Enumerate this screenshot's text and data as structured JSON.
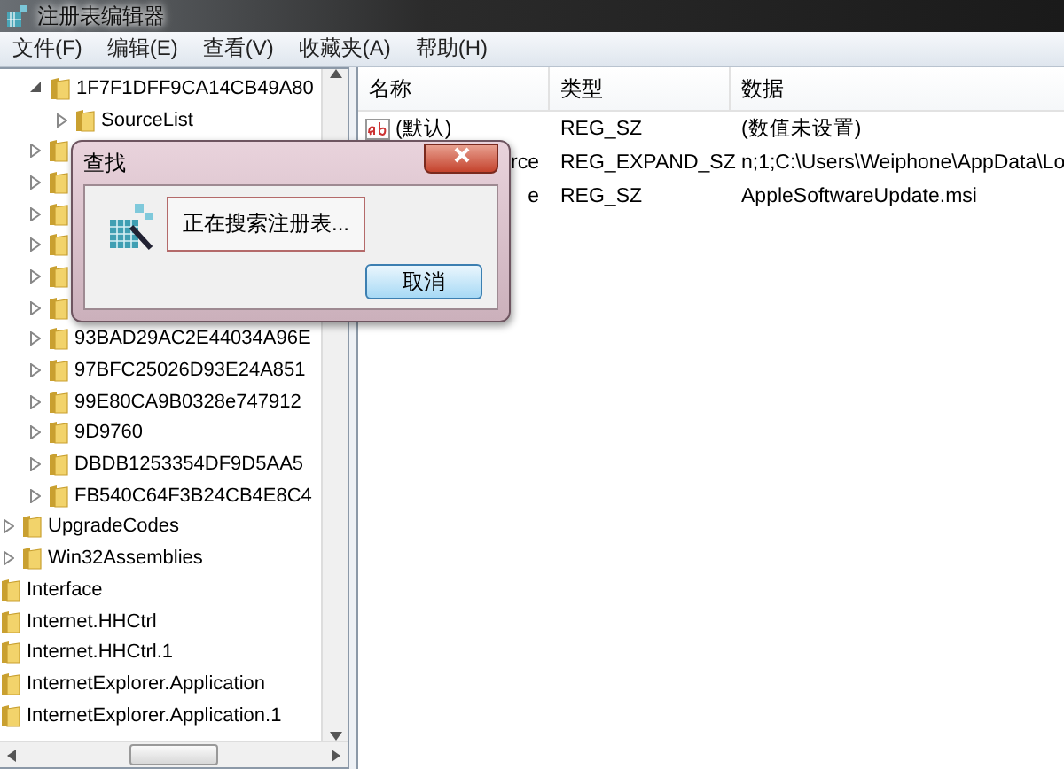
{
  "window": {
    "title": "注册表编辑器"
  },
  "menu": [
    "文件(F)",
    "编辑(E)",
    "查看(V)",
    "收藏夹(A)",
    "帮助(H)"
  ],
  "tree": [
    {
      "children": [
        {
          "children": [
            {
              "label": "1F7F1DFF9CA14CB49A80",
              "expanded": true,
              "children": [
                {
                  "label": "SourceList",
                  "expanded": false
                }
              ]
            },
            {
              "expanded": false
            },
            {
              "expanded": false
            },
            {
              "expanded": false
            },
            {
              "expanded": false
            },
            {
              "expanded": false
            },
            {
              "expanded": false
            },
            {
              "label": "93BAD29AC2E44034A96E",
              "expanded": false
            },
            {
              "label": "97BFC25026D93E24A851",
              "expanded": false
            },
            {
              "label": "99E80CA9B0328e747912",
              "expanded": false
            },
            {
              "label": "9D9760",
              "expanded": false
            },
            {
              "label": "DBDB1253354DF9D5AA5",
              "expanded": false
            },
            {
              "label": "FB540C64F3B24CB4E8C4",
              "expanded": false
            }
          ]
        },
        {
          "label": "UpgradeCodes",
          "expanded": false
        },
        {
          "label": "Win32Assemblies",
          "expanded": false
        }
      ]
    },
    {
      "label": "Interface"
    },
    {
      "label": "Internet.HHCtrl"
    },
    {
      "label": "Internet.HHCtrl.1"
    },
    {
      "label": "InternetExplorer.Application"
    },
    {
      "label": "InternetExplorer.Application.1"
    }
  ],
  "table": {
    "columns": [
      "名称",
      "类型",
      "数据"
    ],
    "rows": [
      {
        "name": "(默认)",
        "type": "REG_SZ",
        "data": "(数值未设置)"
      },
      {
        "name": "rce",
        "type": "REG_EXPAND_SZ",
        "data": "n;1;C:\\Users\\Weiphone\\AppData\\Lo"
      },
      {
        "name": "e",
        "type": "REG_SZ",
        "data": "AppleSoftwareUpdate.msi"
      }
    ]
  },
  "dialog": {
    "title": "查找",
    "message": "正在搜索注册表...",
    "button": "取消"
  }
}
